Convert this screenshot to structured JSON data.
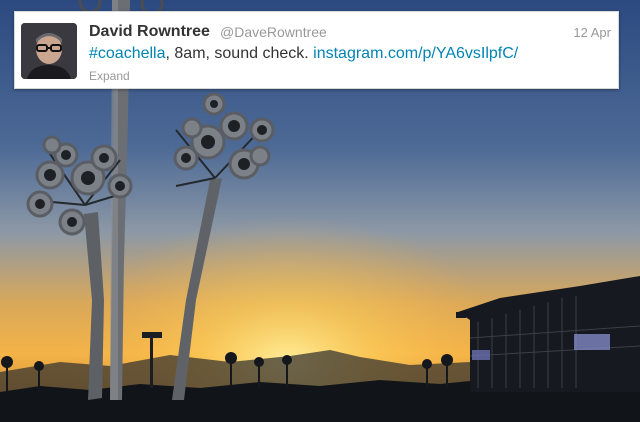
{
  "tweet": {
    "display_name": "David Rowntree",
    "handle": "@DaveRowntree",
    "timestamp": "12 Apr",
    "hashtag": "#coachella",
    "text_middle": ", 8am, sound check. ",
    "link": "instagram.com/p/YA6vsIlpfC/",
    "expand_label": "Expand"
  },
  "photo": {
    "subject": "festival sunset with dandelion sculptures and stage",
    "colors": {
      "sky_top": "#2f4f86",
      "sky_mid": "#6d86a6",
      "horizon": "#f0b24a",
      "glow": "#ffd36a",
      "ground": "#0d1014"
    }
  },
  "icons": {
    "avatar": "user-photo"
  }
}
